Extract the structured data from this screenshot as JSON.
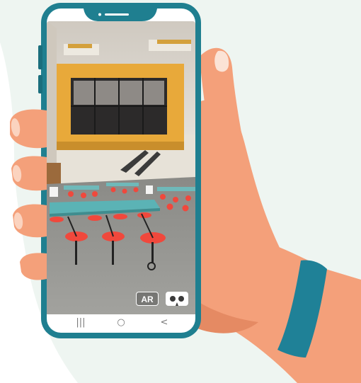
{
  "scene": {
    "description_free": true,
    "ar_label": "AR",
    "vr_icon": "vr-headset-icon"
  },
  "navbar": {
    "recents_glyph": "|||",
    "home_glyph": "○",
    "back_glyph": "<"
  },
  "colors": {
    "background_blob": "#eef5f1",
    "phone_frame": "#1f7f90",
    "skin": "#f4a07a",
    "skin_shadow": "#e58a63",
    "wristband": "#1f8197",
    "accent_yellow": "#e8a93a",
    "stool_red": "#f0483c",
    "table_teal": "#5bb3b5"
  }
}
